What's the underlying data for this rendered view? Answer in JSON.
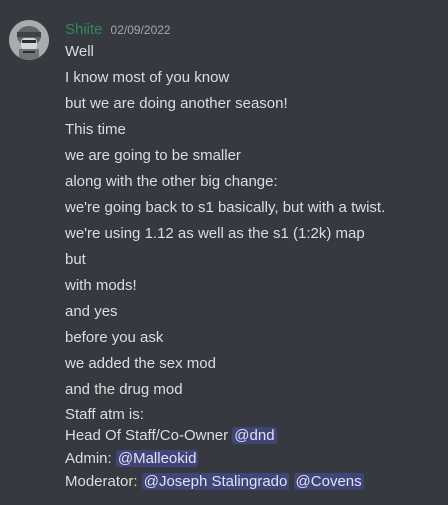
{
  "author": {
    "username": "Shiite",
    "timestamp": "02/09/2022",
    "avatar_icon": "soldier-avatar-icon",
    "name_color": "#2e8b57"
  },
  "messages": [
    "Well",
    "I know most of you know",
    "but we are doing another season!",
    "This time",
    "we are going to be smaller",
    "along with the other big change:",
    "we're going back to s1 basically, but with a twist.",
    "we're using 1.12 as well as the s1 (1:2k) map",
    "but",
    "with mods!",
    "and yes",
    "before you ask",
    "we added the sex mod",
    "and the drug mod"
  ],
  "staff_block": {
    "heading": "Staff atm is:",
    "rows": [
      {
        "label": "Head Of Staff/Co-Owner",
        "mentions": [
          "@dnd"
        ]
      },
      {
        "label": "Admin:",
        "mentions": [
          "@Malleokid"
        ]
      },
      {
        "label": "Moderator:",
        "mentions": [
          "@Joseph Stalingrado",
          "@Covens"
        ]
      }
    ]
  },
  "colors": {
    "background": "#36393f",
    "text": "#dcddde",
    "timestamp": "#a3a6aa",
    "mention_bg": "rgba(88,101,242,0.3)",
    "mention_text": "#dee0fc"
  }
}
